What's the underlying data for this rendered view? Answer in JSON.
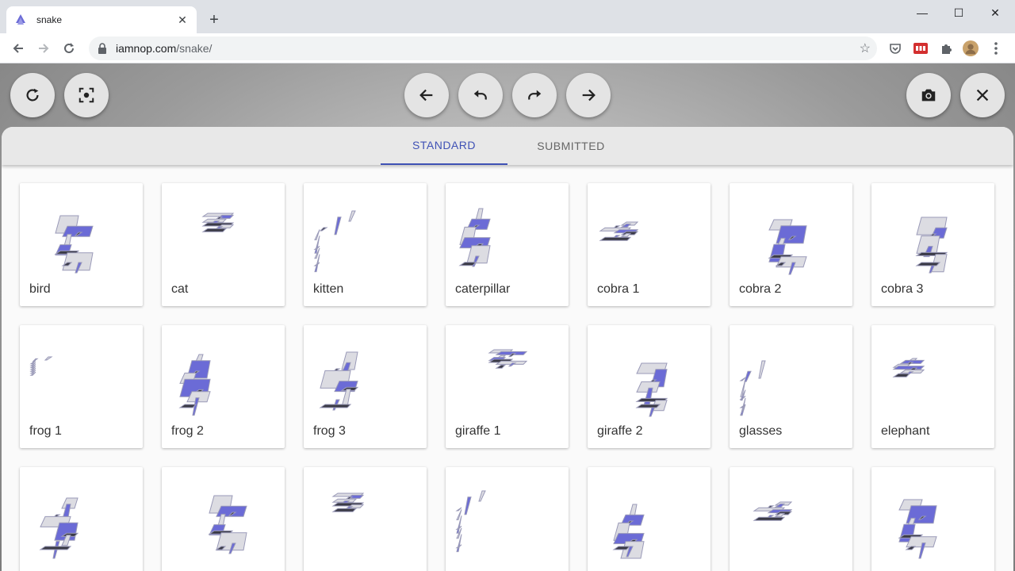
{
  "browser": {
    "tab_title": "snake",
    "url_host": "iamnop.com",
    "url_path": "/snake/",
    "new_tab": "+",
    "tab_close": "✕",
    "minimize": "—",
    "maximize": "☐",
    "close": "✕"
  },
  "app": {
    "controls_left": [
      "reset-icon",
      "focus-icon"
    ],
    "controls_center": [
      "previous-arrow-icon",
      "undo-icon",
      "redo-icon",
      "next-arrow-icon"
    ],
    "controls_right": [
      "camera-icon",
      "close-icon"
    ]
  },
  "tabs": {
    "standard": "STANDARD",
    "submitted": "SUBMITTED"
  },
  "accent_color": "#3f51b5",
  "shape_color": "#6b6bd6",
  "cards": [
    {
      "label": "bird"
    },
    {
      "label": "cat"
    },
    {
      "label": "kitten"
    },
    {
      "label": "caterpillar"
    },
    {
      "label": "cobra 1"
    },
    {
      "label": "cobra 2"
    },
    {
      "label": "cobra 3"
    },
    {
      "label": "frog 1"
    },
    {
      "label": "frog 2"
    },
    {
      "label": "frog 3"
    },
    {
      "label": "giraffe 1"
    },
    {
      "label": "giraffe 2"
    },
    {
      "label": "glasses"
    },
    {
      "label": "elephant"
    },
    {
      "label": ""
    },
    {
      "label": ""
    },
    {
      "label": ""
    },
    {
      "label": ""
    },
    {
      "label": ""
    },
    {
      "label": ""
    },
    {
      "label": ""
    }
  ]
}
